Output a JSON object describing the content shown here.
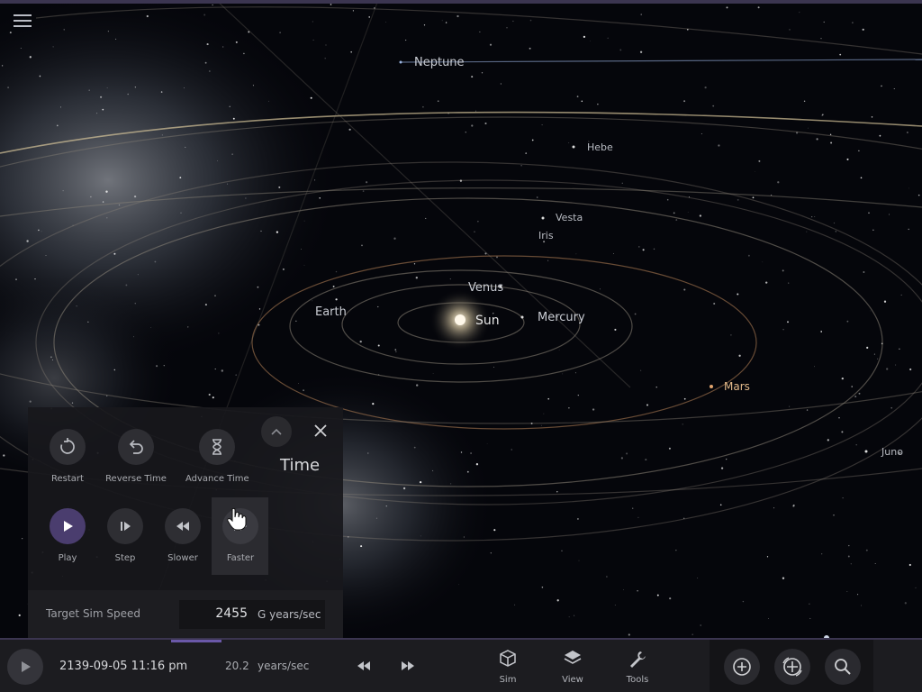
{
  "scene": {
    "labels": {
      "neptune": "Neptune",
      "hebe": "Hebe",
      "vesta": "Vesta",
      "iris": "Iris",
      "venus": "Venus",
      "earth": "Earth",
      "sun": "Sun",
      "mercury": "Mercury",
      "mars": "Mars",
      "juno": "Juno"
    }
  },
  "time_panel": {
    "title": "Time",
    "buttons": {
      "restart": "Restart",
      "reverse": "Reverse Time",
      "advance": "Advance Time",
      "play": "Play",
      "step": "Step",
      "slower": "Slower",
      "faster": "Faster"
    },
    "target_speed_label": "Target Sim Speed",
    "target_speed_value": "2455",
    "target_speed_unit": "G years/sec"
  },
  "bottom_bar": {
    "datetime": "2139-09-05 11:16 pm",
    "rate_value": "20.2",
    "rate_unit": "years/sec",
    "menus": {
      "sim": "Sim",
      "view": "View",
      "tools": "Tools"
    }
  },
  "colors": {
    "accent": "#4a3d6e",
    "panel": "#18181c",
    "bar": "#1c1c20"
  }
}
